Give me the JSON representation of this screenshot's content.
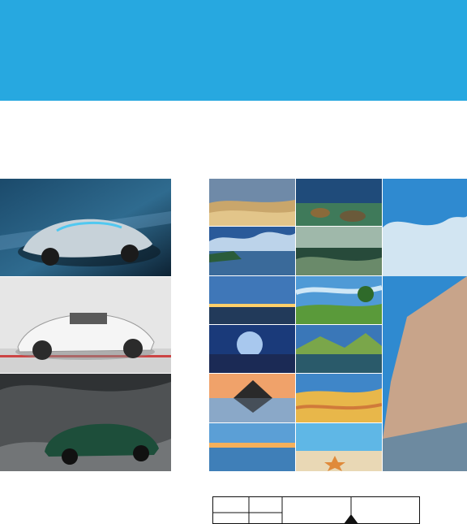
{
  "header": {
    "color": "#27a8e0"
  },
  "galleries": {
    "cars": {
      "items": [
        {
          "name": "concept-car-photo",
          "palette": [
            "#1b4a6b",
            "#5c8aa8",
            "#c7d2d9"
          ]
        },
        {
          "name": "white-sports-car-photo",
          "palette": [
            "#e6e6e6",
            "#bcbcbc",
            "#5a5a5a"
          ]
        },
        {
          "name": "green-muscle-car-photo",
          "palette": [
            "#2f3234",
            "#6a6e70",
            "#1d4e3a"
          ]
        }
      ]
    },
    "landscapes": {
      "items": [
        {
          "name": "desert-dunes-photo",
          "palette": [
            "#6f8aa8",
            "#c9a66b",
            "#e2c58a"
          ]
        },
        {
          "name": "rocky-lake-photo",
          "palette": [
            "#1f4b7a",
            "#3f7a5a",
            "#8a6a3a"
          ]
        },
        {
          "name": "cloudy-river-photo",
          "palette": [
            "#2a5a9a",
            "#bcd3ea",
            "#2a5c3a"
          ]
        },
        {
          "name": "coastline-rocks-photo",
          "palette": [
            "#274a3a",
            "#6a8a6a",
            "#9fb8aa"
          ]
        },
        {
          "name": "sunset-sea-photo",
          "palette": [
            "#3f77b8",
            "#ffcf6a",
            "#223a5a"
          ]
        },
        {
          "name": "green-field-tree-photo",
          "palette": [
            "#4f9ad6",
            "#cfe7f6",
            "#5a9a3a"
          ]
        },
        {
          "name": "moon-over-water-photo",
          "palette": [
            "#1a3a7a",
            "#a8c8ee",
            "#1b2a55"
          ]
        },
        {
          "name": "mountain-lake-photo",
          "palette": [
            "#3a77b8",
            "#7aa64a",
            "#2a5a6a"
          ]
        },
        {
          "name": "mountain-reflection-photo",
          "palette": [
            "#f0a26a",
            "#8aa8c8",
            "#2a2a2a"
          ]
        },
        {
          "name": "golden-dunes-photo",
          "palette": [
            "#3f86c8",
            "#e8b74a",
            "#d07a3a"
          ]
        },
        {
          "name": "calm-horizon-photo",
          "palette": [
            "#f5b05a",
            "#5b9fd6",
            "#3f7fb8"
          ]
        },
        {
          "name": "beach-starfish-photo",
          "palette": [
            "#5fb7e6",
            "#e9d8b5",
            "#e08a3a"
          ]
        },
        {
          "name": "cliff-sky-tall-photo",
          "palette": [
            "#2f8ad0",
            "#eef4f8",
            "#c8a48a"
          ]
        }
      ]
    }
  }
}
